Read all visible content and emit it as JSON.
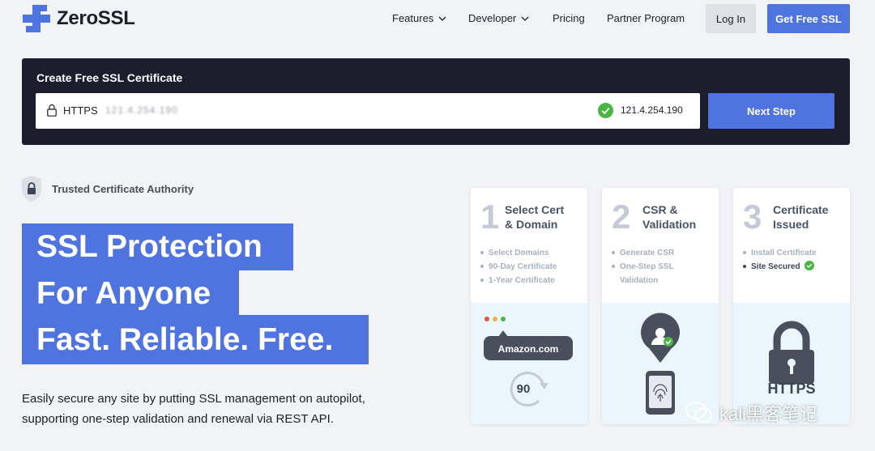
{
  "brand": {
    "name": "ZeroSSL",
    "accent": "#4f74df",
    "dark": "#1c1e2e"
  },
  "nav": {
    "features": "Features",
    "developer": "Developer",
    "pricing": "Pricing",
    "partner": "Partner Program",
    "login": "Log In",
    "get_free": "Get Free SSL"
  },
  "create": {
    "title": "Create Free SSL Certificate",
    "protocol": "HTTPS",
    "url_value": "121.4.254.190",
    "detected_ip": "121.4.254.190",
    "next": "Next Step"
  },
  "trusted": {
    "text": "Trusted Certificate Authority",
    "icon": "lock-shield-icon"
  },
  "hero": {
    "line1": "SSL Protection",
    "line2": "For Anyone",
    "line3": "Fast. Reliable. Free.",
    "desc1": "Easily secure any site by putting SSL management on autopilot,",
    "desc2": "supporting one-step validation and renewal via REST API."
  },
  "steps": [
    {
      "num": "1",
      "title1": "Select Cert",
      "title2": "& Domain",
      "items": [
        "Select Domains",
        "90-Day Certificate",
        "1-Year Certificate"
      ],
      "badge": "Amazon.com",
      "counter": "90"
    },
    {
      "num": "2",
      "title1": "CSR &",
      "title2": "Validation",
      "items": [
        "Generate CSR",
        "One-Step SSL Validation"
      ]
    },
    {
      "num": "3",
      "title1": "Certificate",
      "title2": "Issued",
      "items": [
        "Install Certificate",
        "Site Secured"
      ],
      "badge": "HTTPS"
    }
  ],
  "watermark": "kali黑客笔记"
}
